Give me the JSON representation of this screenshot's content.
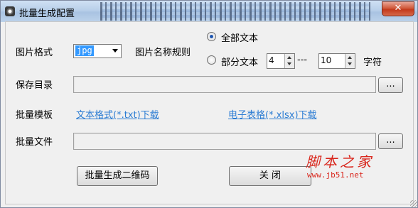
{
  "window": {
    "title": "批量生成配置",
    "close_label": "✕"
  },
  "image_format": {
    "label": "图片格式",
    "selected": "jpg"
  },
  "image_naming": {
    "label": "图片名称规则",
    "option_full": "全部文本",
    "option_partial": "部分文本",
    "selected": "全部文本",
    "partial_from": "4",
    "separator": "---",
    "partial_to": "10",
    "unit": "字符"
  },
  "save_dir": {
    "label": "保存目录",
    "value": "",
    "browse_label": "..."
  },
  "template": {
    "label": "批量模板",
    "txt_link": "文本格式(*.txt)下载",
    "xlsx_link": "电子表格(*.xlsx)下载"
  },
  "batch_file": {
    "label": "批量文件",
    "value": "",
    "browse_label": "..."
  },
  "actions": {
    "generate_label": "批量生成二维码",
    "close_label": "关 闭"
  },
  "watermark": {
    "text": "脚本之家",
    "url": "www.jb51.net"
  },
  "colors": {
    "link": "#2b7cd3",
    "selection": "#3399ff",
    "close_button": "#c3391b",
    "watermark": "#d9261c"
  }
}
